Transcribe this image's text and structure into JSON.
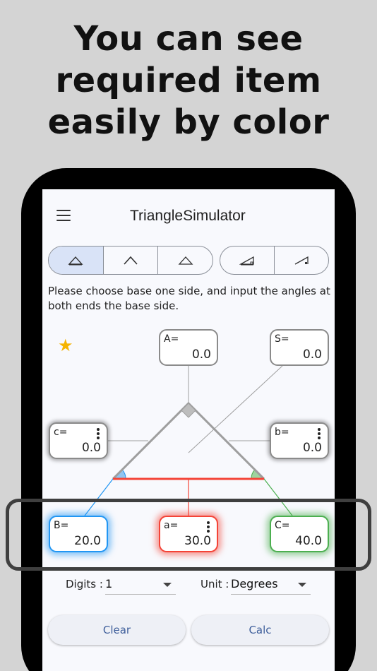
{
  "headline": {
    "line1": "You can see",
    "line2": "required item",
    "line3": "easily by color"
  },
  "app": {
    "title": "TriangleSimulator"
  },
  "mode_tabs": [
    {
      "icon": "triangle-base-angles-icon",
      "selected": true
    },
    {
      "icon": "triangle-apex-angle-icon",
      "selected": false
    },
    {
      "icon": "triangle-outline-icon",
      "selected": false
    },
    {
      "icon": "right-triangle-icon",
      "selected": false
    },
    {
      "icon": "right-triangle-alt-icon",
      "selected": false
    }
  ],
  "instruction": "Please choose base one side, and input the angles at both ends the base side.",
  "fields": {
    "A": {
      "label": "A=",
      "value": "0.0"
    },
    "S": {
      "label": "S=",
      "value": "0.0"
    },
    "c": {
      "label": "c=",
      "value": "0.0"
    },
    "b": {
      "label": "b=",
      "value": "0.0"
    },
    "B": {
      "label": "B=",
      "value": "20.0"
    },
    "a": {
      "label": "a=",
      "value": "30.0"
    },
    "C": {
      "label": "C=",
      "value": "40.0"
    }
  },
  "colors": {
    "B": "#2196f3",
    "a": "#f44336",
    "C": "#4caf50",
    "star": "#f5b400",
    "accent": "#3f5f9b"
  },
  "digits": {
    "label": "Digits :",
    "value": "1"
  },
  "unit": {
    "label": "Unit :",
    "value": "Degrees"
  },
  "buttons": {
    "clear": "Clear",
    "calc": "Calc"
  }
}
